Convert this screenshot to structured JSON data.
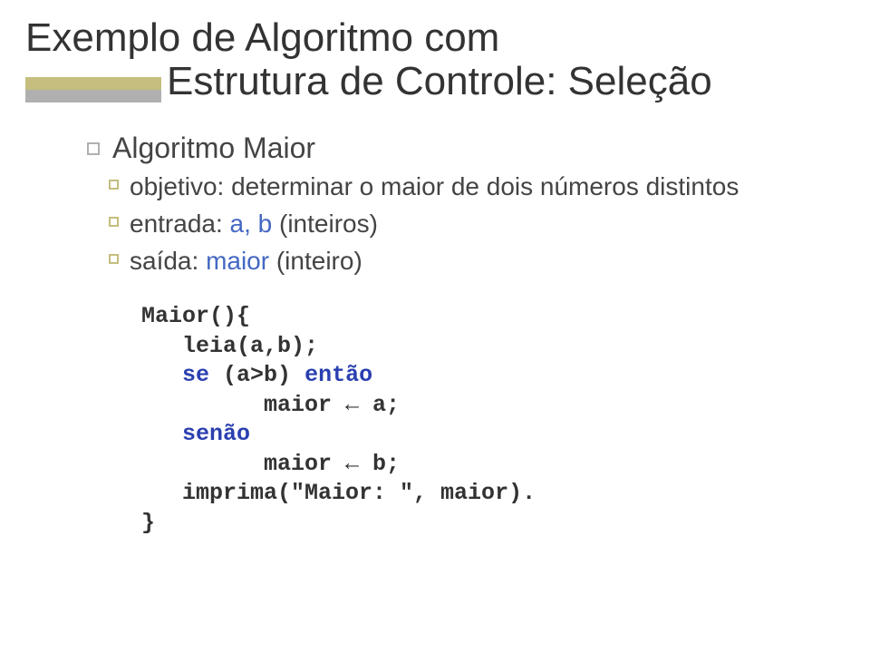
{
  "title_line1": "Exemplo de Algoritmo com",
  "title_line2": "Estrutura de Controle: Seleção",
  "bullets": {
    "l1": "Algoritmo Maior",
    "l2a": "objetivo: determinar o maior de dois números distintos",
    "l2b_pre": "entrada: ",
    "l2b_hl": "a, b",
    "l2b_post": " (inteiros)",
    "l2c_pre": "saída: ",
    "l2c_hl": "maior",
    "l2c_post": " (inteiro)"
  },
  "code": {
    "l1": "Maior(){",
    "l2": "   leia(a,b);",
    "l3_pre": "   ",
    "l3_kw1": "se",
    "l3_mid": " (a>b) ",
    "l3_kw2": "então",
    "l4": "         maior ← a;",
    "l5_pre": "   ",
    "l5_kw": "senão",
    "l6": "         maior ← b;",
    "l7": "   imprima(\"Maior: \", maior).",
    "l8": "}"
  }
}
